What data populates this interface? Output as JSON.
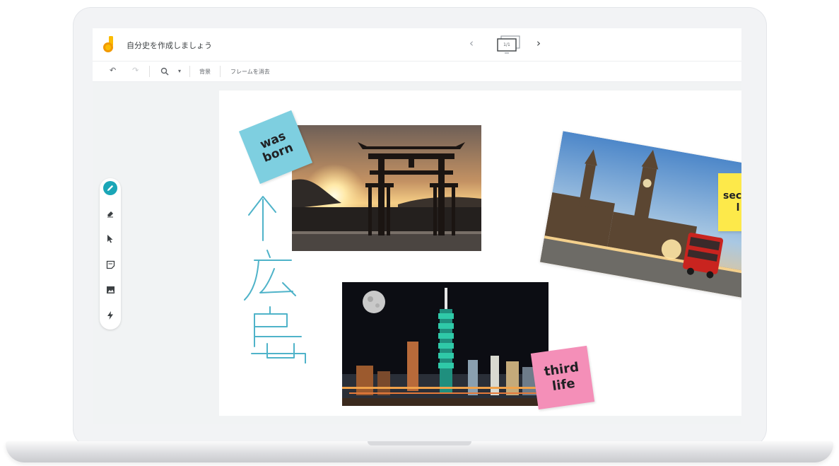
{
  "app": {
    "title": "自分史を作成しましょう",
    "frame_indicator": "1/1"
  },
  "toolbar": {
    "zoom_dropdown": "▾",
    "background_label": "背景",
    "clear_frame_label": "フレームを消去"
  },
  "tools": [
    {
      "name": "pen-tool",
      "icon": "pen-icon",
      "active": true
    },
    {
      "name": "eraser-tool",
      "icon": "eraser-icon"
    },
    {
      "name": "select-tool",
      "icon": "cursor-icon"
    },
    {
      "name": "sticky-note-tool",
      "icon": "sticky-note-icon"
    },
    {
      "name": "image-tool",
      "icon": "image-icon"
    },
    {
      "name": "laser-tool",
      "icon": "laser-icon"
    }
  ],
  "canvas": {
    "notes": [
      {
        "text": "was born",
        "line1": "was",
        "line2": "born",
        "color": "#7ecfe0"
      },
      {
        "text": "second life",
        "line1": "sec",
        "line2": "l",
        "color": "#fde94a"
      },
      {
        "text": "third life",
        "line1": "third",
        "line2": "life",
        "color": "#f48fb8"
      }
    ],
    "handwriting": {
      "text": "↑広島",
      "color": "#4fb3c9"
    },
    "photos": [
      "torii-gate-sunset",
      "london-big-ben",
      "taipei-101-night"
    ]
  },
  "colors": {
    "accent": "#1aa6b7",
    "laptop_body": "#f2f3f5"
  }
}
